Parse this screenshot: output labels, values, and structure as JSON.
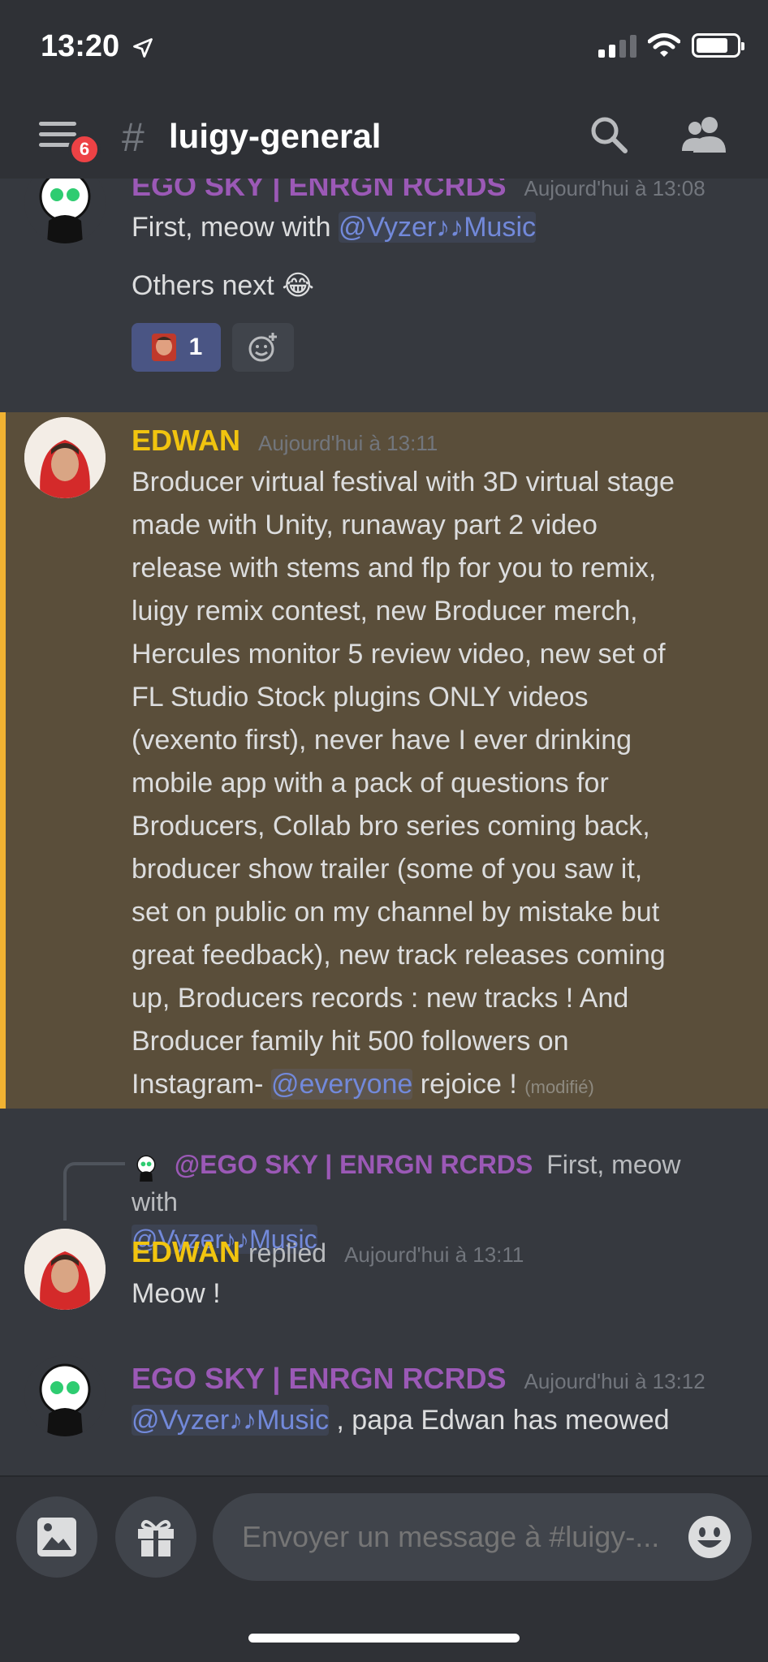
{
  "status_bar": {
    "time": "13:20"
  },
  "header": {
    "badge_count": "6",
    "channel_hash": "#",
    "channel_name": "luigy-general"
  },
  "messages": [
    {
      "author": "EGO SKY | ENRGN RCRDS",
      "timestamp": "Aujourd'hui à 13:08",
      "line1_prefix": "First, meow with ",
      "line1_mention": "@Vyzer♪♪Music",
      "line2": "Others next 😂",
      "reactions": [
        {
          "count": "1"
        }
      ]
    },
    {
      "author": "EDWAN",
      "timestamp": "Aujourd'hui à 13:11",
      "lines": [
        "Broducer virtual festival with 3D virtual stage",
        "made with Unity, runaway part 2 video",
        "release with stems and flp for you to remix,",
        "luigy remix contest, new Broducer merch,",
        "Hercules monitor 5 review video, new set of",
        "FL Studio Stock plugins ONLY videos",
        "(vexento first), never have I ever drinking",
        "mobile app with a pack of questions for",
        "Broducers, Collab bro series coming back,",
        "broducer show trailer (some of you saw it,",
        "set on public on my channel by mistake but",
        "great feedback), new track releases coming",
        "up, Broducers records : new tracks ! And",
        "Broducer family hit 500 followers on"
      ],
      "last_prefix": "Instagram- ",
      "last_mention": "@everyone",
      "last_suffix": " rejoice !",
      "edited": "(modifié)"
    },
    {
      "reply_author": "@EGO SKY | ENRGN RCRDS",
      "reply_text": "First, meow with",
      "reply_mention": "@Vyzer♪♪Music",
      "author": "EDWAN",
      "replied_label": "replied",
      "timestamp": "Aujourd'hui à 13:11",
      "text": "Meow !"
    },
    {
      "author": "EGO SKY | ENRGN RCRDS",
      "timestamp": "Aujourd'hui à 13:12",
      "mention": "@Vyzer♪♪Music",
      "text_suffix": " , papa Edwan has meowed"
    }
  ],
  "composer": {
    "placeholder": "Envoyer un message à #luigy-..."
  },
  "colors": {
    "background": "#36393f",
    "header": "#2f3136",
    "highlight": "#5a4e3a",
    "highlight_bar": "#f0b232",
    "purple": "#9b59b6",
    "gold": "#f1c40f",
    "mention": "#7289da"
  },
  "icons": [
    "location-arrow-icon",
    "signal-icon",
    "wifi-icon",
    "battery-icon",
    "menu-icon",
    "search-icon",
    "members-icon",
    "add-reaction-icon",
    "image-icon",
    "gift-icon",
    "emoji-icon"
  ]
}
